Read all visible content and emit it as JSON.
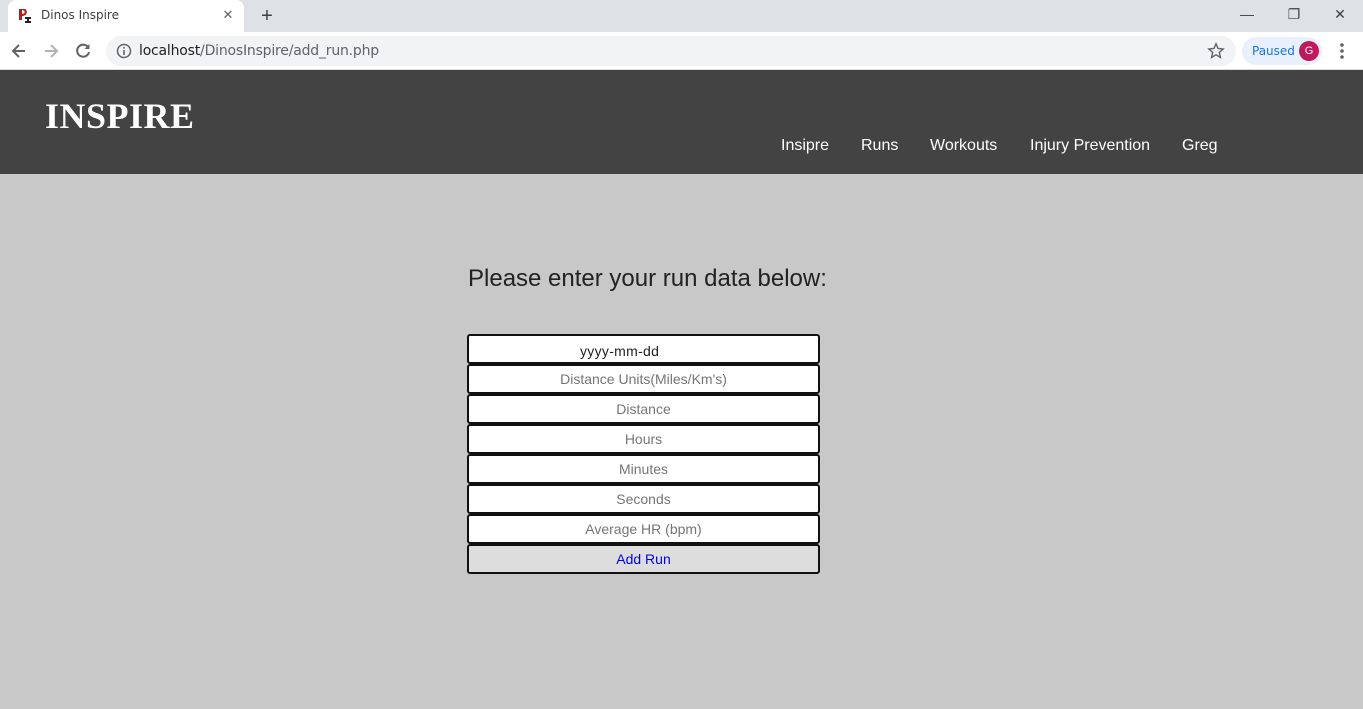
{
  "browser": {
    "tab_title": "Dinos Inspire",
    "url_host": "localhost",
    "url_path": "/DinosInspire/add_run.php",
    "profile_status": "Paused",
    "profile_initial": "G",
    "tab_close_symbol": "✕",
    "new_tab_symbol": "+",
    "window_controls": {
      "minimize": "—",
      "restore": "❐",
      "close": "✕"
    }
  },
  "site": {
    "logo": "INSPIRE",
    "nav": [
      "Insipre",
      "Runs",
      "Workouts",
      "Injury Prevention",
      "Greg"
    ]
  },
  "form": {
    "heading": "Please enter your run data below:",
    "date_format": "yyyy-mm-dd",
    "fields": [
      {
        "placeholder": "Distance Units(Miles/Km's)"
      },
      {
        "placeholder": "Distance"
      },
      {
        "placeholder": "Hours"
      },
      {
        "placeholder": "Minutes"
      },
      {
        "placeholder": "Seconds"
      },
      {
        "placeholder": "Average HR (bpm)"
      }
    ],
    "submit_label": "Add Run"
  },
  "colors": {
    "header_bg": "#434343",
    "page_bg": "#c8c8c8",
    "submit_text": "#0000ee",
    "avatar": "#c2185b"
  }
}
